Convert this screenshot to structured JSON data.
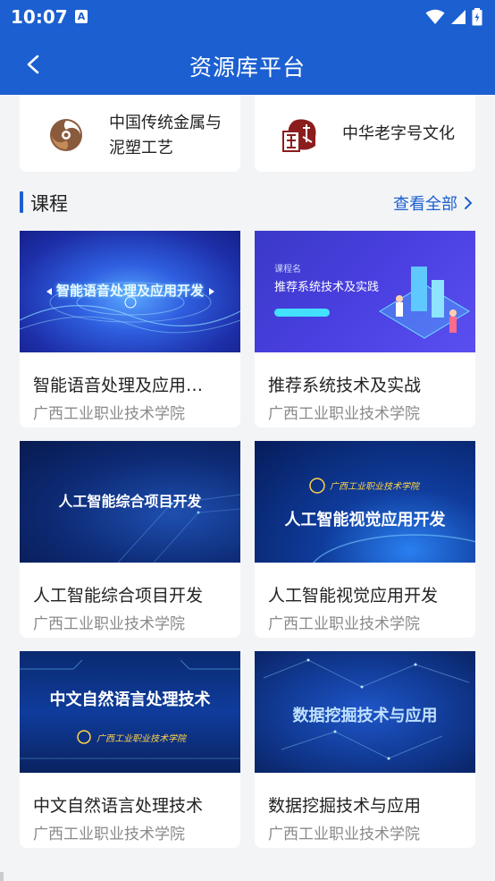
{
  "status_bar": {
    "time": "10:07",
    "notif_icon": "A"
  },
  "nav": {
    "title": "资源库平台"
  },
  "top_cards": [
    {
      "name": "中国传统金属与泥塑工艺"
    },
    {
      "name": "中华老字号文化"
    }
  ],
  "section": {
    "label": "课程",
    "more_label": "查看全部"
  },
  "courses": [
    {
      "title": "智能语音处理及应用…",
      "school": "广西工业职业技术学院",
      "thumb_text": "智能语音处理及应用开发"
    },
    {
      "title": "推荐系统技术及实战",
      "school": "广西工业职业技术学院",
      "thumb_kicker": "课程名",
      "thumb_text": "推荐系统技术及实践"
    },
    {
      "title": "人工智能综合项目开发",
      "school": "广西工业职业技术学院",
      "thumb_text": "人工智能综合项目开发"
    },
    {
      "title": "人工智能视觉应用开发",
      "school": "广西工业职业技术学院",
      "thumb_school": "广西工业职业技术学院",
      "thumb_text": "人工智能视觉应用开发"
    },
    {
      "title": "中文自然语言处理技术",
      "school": "广西工业职业技术学院",
      "thumb_text": "中文自然语言处理技术",
      "thumb_school": "广西工业职业技术学院"
    },
    {
      "title": "数据挖掘技术与应用",
      "school": "广西工业职业技术学院",
      "thumb_text": "数据挖掘技术与应用"
    }
  ],
  "colors": {
    "brand": "#1b5fd1",
    "page_bg": "#f3f4f6"
  }
}
